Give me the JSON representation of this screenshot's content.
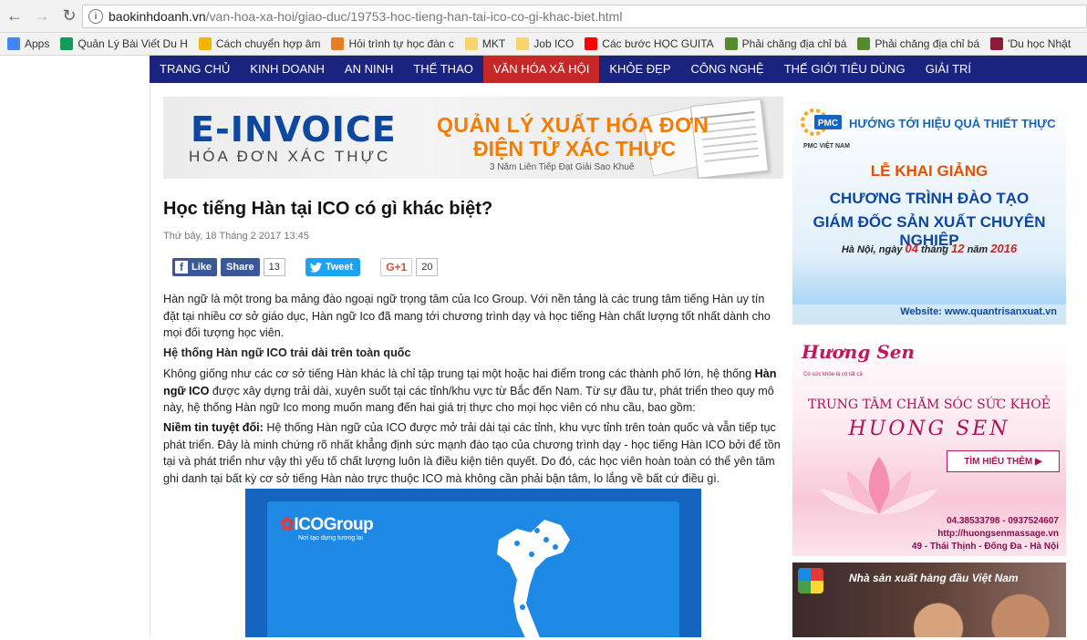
{
  "browser": {
    "url_host": "baokinhdoanh.vn",
    "url_path": "/van-hoa-xa-hoi/giao-duc/19753-hoc-tieng-han-tai-ico-co-gi-khac-biet.html",
    "bookmarks": [
      {
        "label": "Apps",
        "color": "#4285f4"
      },
      {
        "label": "Quản Lý Bài Viết Du H",
        "color": "#0f9d58"
      },
      {
        "label": "Cách chuyển hợp âm",
        "color": "#f4b400"
      },
      {
        "label": "Hỏi trình tự học đàn c",
        "color": "#e67e22"
      },
      {
        "label": "MKT",
        "color": "#f6d36b"
      },
      {
        "label": "Job ICO",
        "color": "#f6d36b"
      },
      {
        "label": "Các bước HỌC GUITA",
        "color": "#ff0000"
      },
      {
        "label": "Phải chăng địa chỉ bá",
        "color": "#558b2f"
      },
      {
        "label": "Phải chăng địa chỉ bá",
        "color": "#558b2f"
      },
      {
        "label": "'Du học Nhật",
        "color": "#8e1a3a"
      }
    ]
  },
  "site_nav": {
    "items": [
      "TRANG CHỦ",
      "KINH DOANH",
      "AN NINH",
      "THỂ THAO",
      "VĂN HÓA XÃ HỘI",
      "KHỎE ĐẸP",
      "CÔNG NGHỆ",
      "THẾ GIỚI TIÊU DÙNG",
      "GIẢI TRÍ"
    ],
    "active_index": 4
  },
  "banner": {
    "logo": "E-INVOICE",
    "logo_sub": "HÓA ĐƠN XÁC THỰC",
    "headline1": "QUẢN LÝ XUẤT HÓA ĐƠN",
    "headline2": "ĐIỆN TỬ XÁC THỰC",
    "tagline": "3 Năm Liên Tiếp Đạt Giải Sao Khuê"
  },
  "article": {
    "title": "Học tiếng Hàn tại ICO có gì khác biệt?",
    "date": "Thứ bảy, 18 Tháng 2 2017 13:45",
    "share": {
      "like_label": "Like",
      "share_label": "Share",
      "share_count": "13",
      "tweet_label": "Tweet",
      "gplus_label": "G+1",
      "gplus_count": "20"
    },
    "p1": "Hàn ngữ là một trong ba mảng đào ngoại ngữ trọng tâm của Ico Group. Với nền tảng là các trung tâm tiếng Hàn uy tín đặt tại nhiều cơ sở giáo dục, Hàn ngữ Ico đã mang tới chương trình dạy và học tiếng Hàn chất lượng tốt nhất dành cho mọi đối tượng học viên.",
    "h1": "Hệ thống Hàn ngữ ICO trải dài trên toàn quốc",
    "p2_a": "Không giống như các cơ sở tiếng Hàn khác là chỉ tập trung tại một hoặc hai điểm trong các thành phố lớn, hệ thống ",
    "p2_b": "Hàn ngữ ICO",
    "p2_c": " được xây dựng trải dài, xuyên suốt tại các tỉnh/khu vực từ Bắc đến Nam. Từ sự đầu tư, phát triển theo quy mô này, hệ thống Hàn ngữ Ico mong muốn mang đến hai giá trị thực cho mọi học viên có nhu cầu, bao gồm:",
    "p3_a": "Niềm tin tuyệt đối:",
    "p3_b": " Hệ thống Hàn ngữ của ICO được mở trải dài tại các tỉnh, khu vực tỉnh trên toàn quốc và vẫn tiếp tục phát triển. Đây là minh chứng rõ nhất khẳng định sức mạnh đào tạo của chương trình dạy - học tiếng Hàn ICO bởi để tồn tại và phát triển như vậy thì yếu tố chất lượng luôn là điều kiện tiên quyết. Do đó, các học viên hoàn toàn có thể yên tâm ghi danh tại bất kỳ cơ sở tiếng Hàn nào trực thuộc ICO mà không cần phải bận tâm, lo lắng về bất cứ điều gì.",
    "image_logo": "ICOGroup",
    "image_tagline": "Nơi tạo dựng tương lai"
  },
  "ads": {
    "pmc": {
      "logo": "PMC",
      "logo_sub": "PMC VIỆT NAM",
      "header": "HƯỚNG TỚI HIỆU QUẢ THIẾT THỰC",
      "line1": "LỄ KHAI GIẢNG",
      "line2": "CHƯƠNG TRÌNH ĐÀO TẠO",
      "line3": "GIÁM ĐỐC SẢN XUẤT CHUYÊN NGHIỆP",
      "date_a": "Hà Nội, ngày ",
      "date_day": "04",
      "date_b": " tháng ",
      "date_month": "12",
      "date_c": " năm ",
      "date_year": "2016",
      "website": "Website: www.quantrisanxuat.vn"
    },
    "huongsen": {
      "logo": "Hương Sen",
      "tag": "Có sức khỏe là có tất cả",
      "title": "TRUNG TÂM CHĂM SÓC SỨC KHOẺ",
      "name": "HUONG SEN",
      "button": "TÌM HIỂU THÊM ▶",
      "phone": "04.38533798 - 0937524607",
      "url": "http://huongsenmassage.vn",
      "address": "49 - Thái Thịnh - Đống Đa - Hà Nội"
    },
    "ad3": {
      "text": "Nhà sản xuất hàng đầu Việt Nam"
    }
  }
}
